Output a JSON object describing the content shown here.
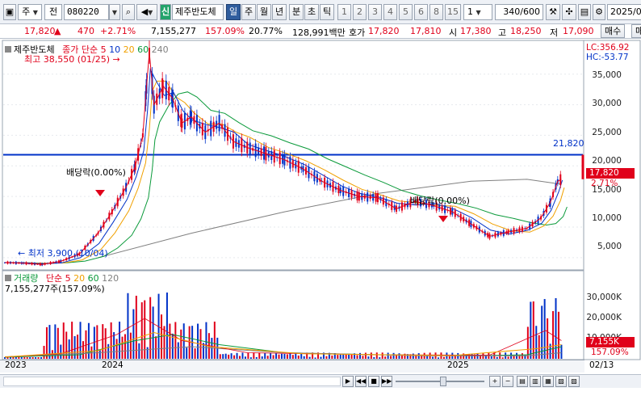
{
  "toolbar": {
    "market": "주",
    "view": "전",
    "code": "080220",
    "new_badge": "신",
    "stock_name": "제주반도체",
    "periods": [
      "일",
      "주",
      "월",
      "년",
      "분",
      "초",
      "틱"
    ],
    "active_period": "일",
    "numbers": [
      "1",
      "2",
      "3",
      "4",
      "5",
      "6",
      "8",
      "15",
      "1"
    ],
    "count": "340",
    "total": "/600",
    "date": "2025/0"
  },
  "quote": {
    "price": "17,820",
    "arrow": "▲",
    "change": "470",
    "change_pct": "+2.71%",
    "volume": "7,155,277",
    "volume_pct": "157.09%",
    "turnover": "20.77%",
    "amount": "128,991백만",
    "hoga_label": "호가",
    "ask": "17,820",
    "bid": "17,810",
    "open_label": "시",
    "open": "17,380",
    "high_label": "고",
    "high": "18,250",
    "low_label": "저",
    "low": "17,090",
    "buy_button": "매수",
    "more_button": "매"
  },
  "price_panel": {
    "name": "제주반도체",
    "ma_label": "종가 단순",
    "ma_periods": [
      "5",
      "10",
      "20",
      "60",
      "240"
    ],
    "ma_colors": [
      "#e0001a",
      "#0032c8",
      "#f0a000",
      "#0a9a3a",
      "#808080"
    ],
    "lc": "LC:356.92",
    "hc": "HC:-53.77",
    "max_label": "최고 38,550 (01/25)",
    "min_label": "최저 3,900 (10/04)",
    "dividend1": "배당락(0.00%)",
    "dividend2": "배당락(0.00%)",
    "hline_value": "21,820",
    "last_price": "17,820",
    "last_pct": "2.71%",
    "yticks": [
      "35,000",
      "30,000",
      "25,000",
      "20,000",
      "15,000",
      "10,000",
      "5,000"
    ]
  },
  "volume_panel": {
    "name": "거래량",
    "ma_label": "단순",
    "ma_periods": [
      "5",
      "20",
      "60",
      "120"
    ],
    "ma_colors": [
      "#e0001a",
      "#f0a000",
      "#0a9a3a",
      "#808080"
    ],
    "volume_label": "7,155,277주(157.09%)",
    "yticks": [
      "30,000K",
      "20,000K",
      "10,000K"
    ],
    "last_vol": "7,155K",
    "last_pct": "157.09%"
  },
  "xaxis": {
    "labels": [
      "2023",
      "2024",
      "2025"
    ],
    "right_label": "02/13"
  },
  "chart_data": {
    "type": "line",
    "title": "제주반도체",
    "ylim": [
      3000,
      38000
    ],
    "reference_line": 21820,
    "series": [
      {
        "name": "종가",
        "points": [
          [
            0,
            4200
          ],
          [
            20,
            4100
          ],
          [
            40,
            3900
          ],
          [
            60,
            4400
          ],
          [
            80,
            5600
          ],
          [
            100,
            9000
          ],
          [
            115,
            12500
          ],
          [
            130,
            16500
          ],
          [
            140,
            20000
          ],
          [
            148,
            25000
          ],
          [
            152,
            33000
          ],
          [
            155,
            38550
          ],
          [
            160,
            30000
          ],
          [
            170,
            33000
          ],
          [
            180,
            31000
          ],
          [
            190,
            27000
          ],
          [
            200,
            28000
          ],
          [
            215,
            25500
          ],
          [
            230,
            27000
          ],
          [
            245,
            24000
          ],
          [
            260,
            23000
          ],
          [
            280,
            22000
          ],
          [
            300,
            21000
          ],
          [
            320,
            19500
          ],
          [
            340,
            17500
          ],
          [
            360,
            16000
          ],
          [
            380,
            15000
          ],
          [
            400,
            14800
          ],
          [
            420,
            13000
          ],
          [
            440,
            14200
          ],
          [
            460,
            13500
          ],
          [
            480,
            12500
          ],
          [
            500,
            10500
          ],
          [
            520,
            8500
          ],
          [
            540,
            9200
          ],
          [
            560,
            9800
          ],
          [
            575,
            11500
          ],
          [
            585,
            14000
          ],
          [
            593,
            17500
          ],
          [
            597,
            17820
          ]
        ]
      },
      {
        "name": "MA240",
        "points": [
          [
            100,
            5000
          ],
          [
            200,
            9000
          ],
          [
            300,
            12500
          ],
          [
            400,
            15500
          ],
          [
            500,
            17500
          ],
          [
            560,
            17800
          ],
          [
            597,
            17000
          ]
        ]
      }
    ],
    "volume_series": {
      "name": "거래량",
      "last": 7155277,
      "ylim": [
        0,
        38000
      ]
    }
  }
}
